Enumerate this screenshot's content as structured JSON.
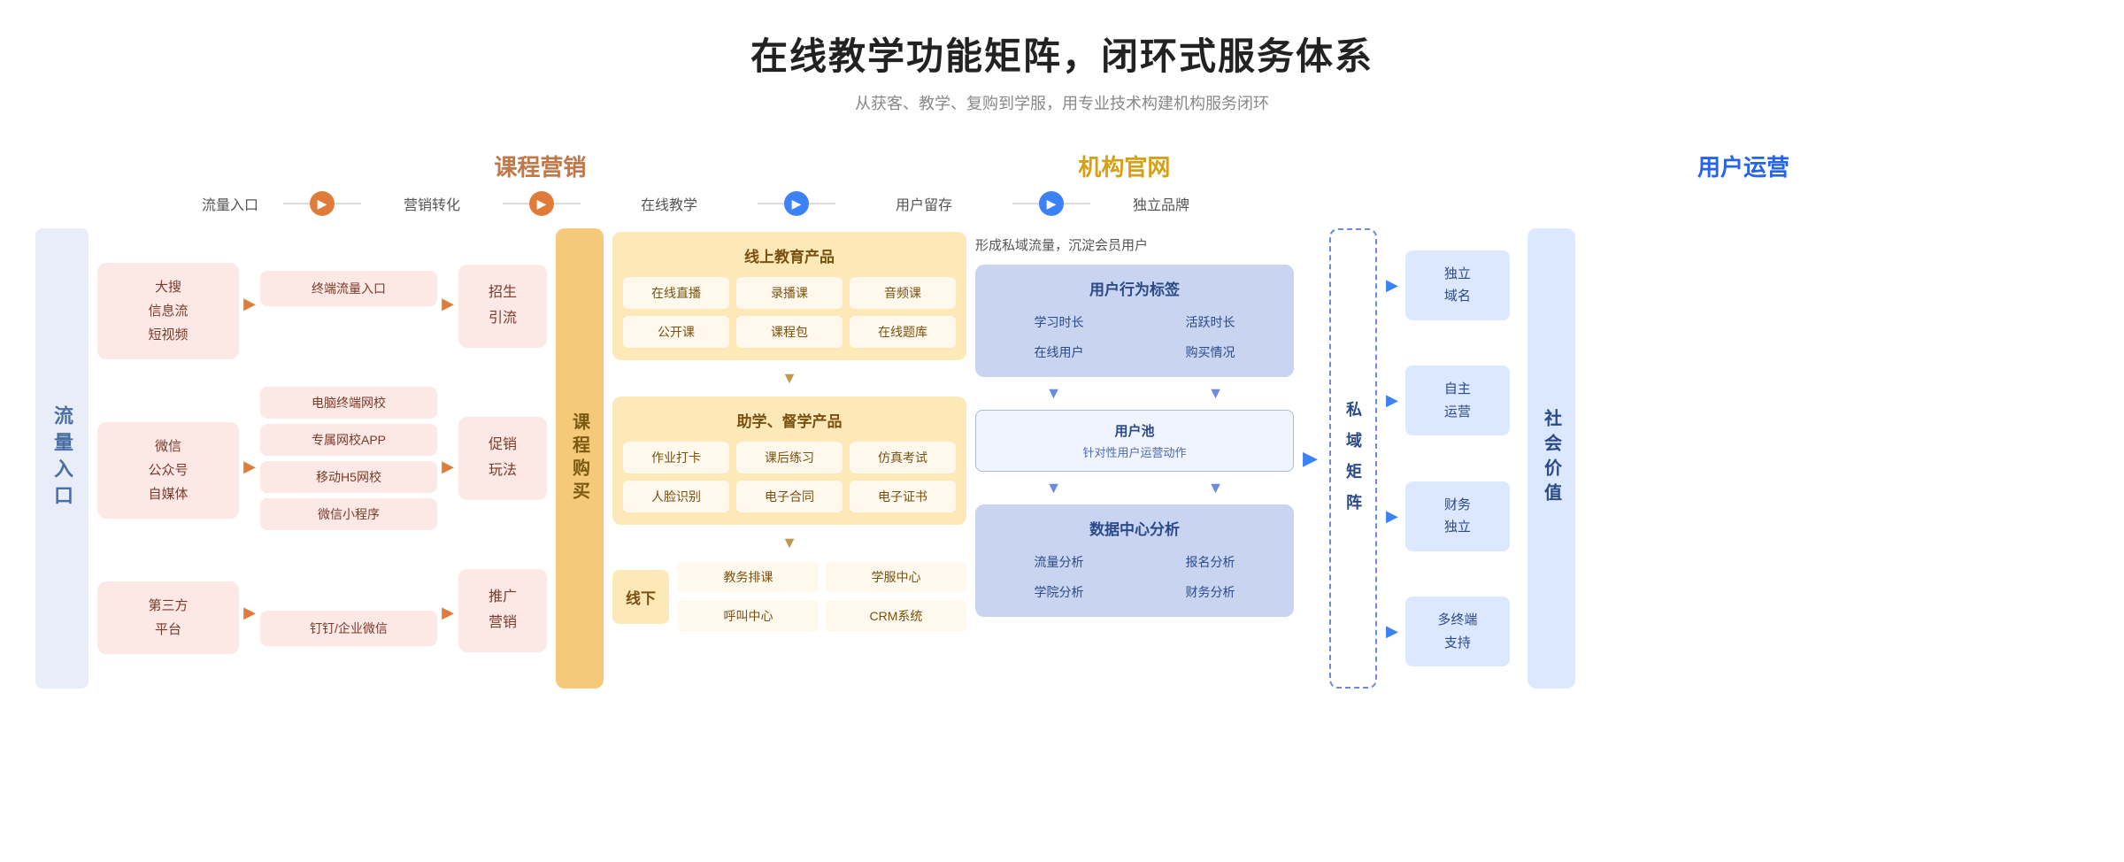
{
  "title": "在线教学功能矩阵，闭环式服务体系",
  "subtitle": "从获客、教学、复购到学服，用专业技术构建机构服务闭环",
  "col_headers": {
    "marketing": "课程营销",
    "official": "机构官网",
    "userops": "用户运营"
  },
  "flow_labels": {
    "traffic": "流量入口",
    "conversion": "营销转化",
    "online": "在线教学",
    "retention": "用户留存",
    "brand": "独立品牌"
  },
  "left_label": "流量入口",
  "traffic_groups": [
    {
      "text": "大搜\n信息流\n短视频"
    },
    {
      "text": "微信\n公众号\n自媒体"
    },
    {
      "text": "第三方\n平台"
    }
  ],
  "marketing_items": [
    {
      "text": "终端流量入口"
    },
    {
      "text": "电脑终端网校"
    },
    {
      "text": "专属网校APP"
    },
    {
      "text": "移动H5网校"
    },
    {
      "text": "微信小程序"
    },
    {
      "text": "钉钉/企业微信"
    }
  ],
  "marketing_boxes": [
    {
      "text": "招生\n引流"
    },
    {
      "text": "促销\n玩法"
    },
    {
      "text": "推广\n营销"
    }
  ],
  "course_buy": "课\n程\n购\n买",
  "online_education": {
    "top_title": "线上教育产品",
    "top_items": [
      "在线直播",
      "录播课",
      "音频课",
      "公开课",
      "课程包",
      "在线题库"
    ],
    "assist_title": "助学、督学产品",
    "assist_items": [
      "作业打卡",
      "课后练习",
      "仿真考试",
      "人脸识别",
      "电子合同",
      "电子证书"
    ],
    "offline_label": "线下",
    "offline_items": [
      "教务排课",
      "学服中心",
      "呼叫中心",
      "CRM系统"
    ]
  },
  "user_section": {
    "private_text": "形成私域流量，沉淀会员用户",
    "tag_title": "用户行为标签",
    "tag_items": [
      "学习时长",
      "活跃时长",
      "在线用户",
      "购买情况"
    ],
    "pool_text": "用户池\n针对性用户运营动作",
    "analysis_title": "数据中心分析",
    "analysis_items": [
      "流量分析",
      "报名分析",
      "学院分析",
      "财务分析"
    ]
  },
  "private_matrix": "私\n域\n矩\n阵",
  "brand_items": [
    {
      "text": "独立\n域名"
    },
    {
      "text": "自主\n运营"
    },
    {
      "text": "财务\n独立"
    },
    {
      "text": "多终端\n支持"
    }
  ],
  "social_value": "社\n会\n价\n值",
  "colors": {
    "orange": "#e07c3a",
    "light_orange": "#fce8e4",
    "warm_yellow": "#fde8b8",
    "light_blue": "#dce8ff",
    "mid_blue": "#c8d4f0",
    "dark_blue": "#2563eb"
  }
}
